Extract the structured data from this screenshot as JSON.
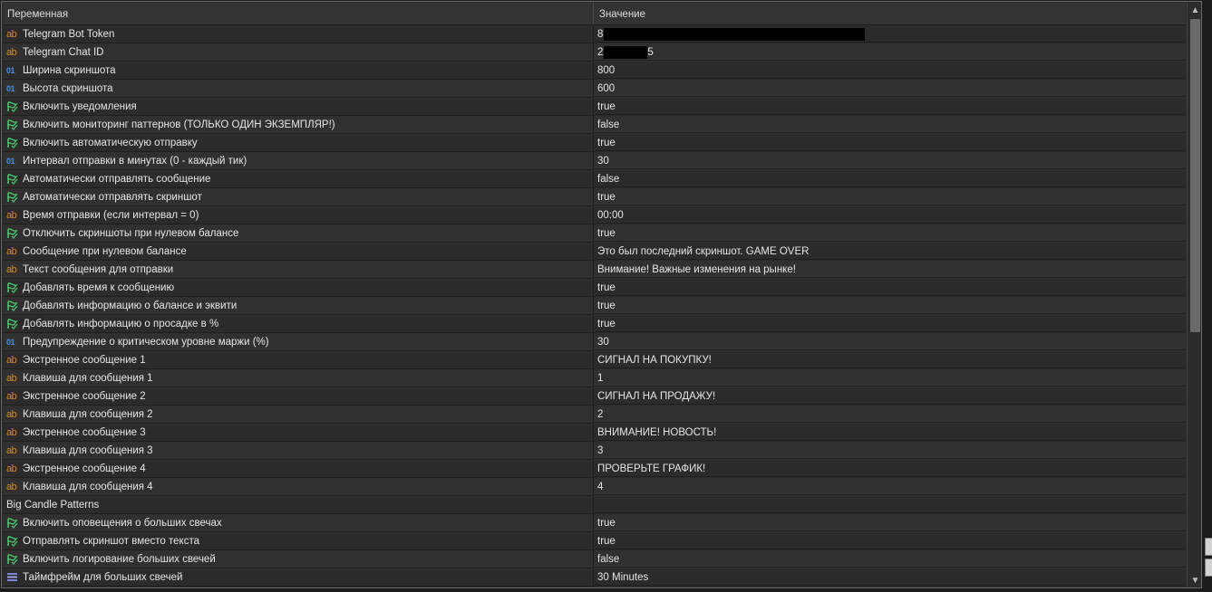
{
  "header": {
    "col_variable": "Переменная",
    "col_value": "Значение"
  },
  "rows": [
    {
      "type": "str",
      "label": "Telegram Bot Token",
      "value": "8",
      "redacted": true
    },
    {
      "type": "str",
      "label": "Telegram Chat ID",
      "value": "2",
      "value_tail": "5",
      "redacted": true
    },
    {
      "type": "int",
      "label": "Ширина скриншота",
      "value": "800"
    },
    {
      "type": "int",
      "label": "Высота скриншота",
      "value": "600"
    },
    {
      "type": "bool",
      "label": "Включить уведомления",
      "value": "true"
    },
    {
      "type": "bool",
      "label": "Включить мониторинг паттернов (ТОЛЬКО ОДИН ЭКЗЕМПЛЯР!)",
      "value": "false"
    },
    {
      "type": "bool",
      "label": "Включить автоматическую отправку",
      "value": "true"
    },
    {
      "type": "int",
      "label": "Интервал отправки в минутах (0 - каждый тик)",
      "value": "30"
    },
    {
      "type": "bool",
      "label": "Автоматически отправлять сообщение",
      "value": "false"
    },
    {
      "type": "bool",
      "label": "Автоматически отправлять скриншот",
      "value": "true"
    },
    {
      "type": "str",
      "label": "Время отправки (если интервал = 0)",
      "value": "00:00"
    },
    {
      "type": "bool",
      "label": "Отключить скриншоты при нулевом балансе",
      "value": "true"
    },
    {
      "type": "str",
      "label": "Сообщение при нулевом балансе",
      "value": "Это был последний скриншот. GAME OVER"
    },
    {
      "type": "str",
      "label": "Текст сообщения для отправки",
      "value": "Внимание! Важные изменения на рынке!"
    },
    {
      "type": "bool",
      "label": "Добавлять время к сообщению",
      "value": "true"
    },
    {
      "type": "bool",
      "label": "Добавлять информацию о балансе и эквити",
      "value": "true"
    },
    {
      "type": "bool",
      "label": "Добавлять информацию о просадке в %",
      "value": "true"
    },
    {
      "type": "int",
      "label": "Предупреждение о критическом уровне маржи (%)",
      "value": "30"
    },
    {
      "type": "str",
      "label": "Экстренное сообщение 1",
      "value": "СИГНАЛ НА ПОКУПКУ!"
    },
    {
      "type": "str",
      "label": "Клавиша для сообщения 1",
      "value": "1"
    },
    {
      "type": "str",
      "label": "Экстренное сообщение 2",
      "value": "СИГНАЛ НА ПРОДАЖУ!"
    },
    {
      "type": "str",
      "label": "Клавиша для сообщения 2",
      "value": "2"
    },
    {
      "type": "str",
      "label": "Экстренное сообщение 3",
      "value": "ВНИМАНИЕ! НОВОСТЬ!"
    },
    {
      "type": "str",
      "label": "Клавиша для сообщения 3",
      "value": "3"
    },
    {
      "type": "str",
      "label": "Экстренное сообщение 4",
      "value": "ПРОВЕРЬТЕ ГРАФИК!"
    },
    {
      "type": "str",
      "label": "Клавиша для сообщения 4",
      "value": "4"
    },
    {
      "type": "group",
      "label": "Big Candle Patterns",
      "value": ""
    },
    {
      "type": "bool",
      "label": "Включить оповещения о больших свечах",
      "value": "true"
    },
    {
      "type": "bool",
      "label": "Отправлять скриншот вместо текста",
      "value": "true"
    },
    {
      "type": "bool",
      "label": "Включить логирование больших свечей",
      "value": "false"
    },
    {
      "type": "enum",
      "label": "Таймфрейм для больших свечей",
      "value": "30 Minutes"
    }
  ],
  "icons": {
    "str": {
      "name": "string-type-icon",
      "glyph": "ab",
      "color": "#d38a2d"
    },
    "int": {
      "name": "integer-type-icon",
      "glyph": "01",
      "color": "#4f8fd8"
    },
    "bool": {
      "name": "boolean-type-icon",
      "color": "#4fbf6a"
    },
    "enum": {
      "name": "enum-type-icon",
      "color": "#7c86d8"
    }
  },
  "scrollbar": {
    "up": "▲",
    "down": "▼"
  }
}
